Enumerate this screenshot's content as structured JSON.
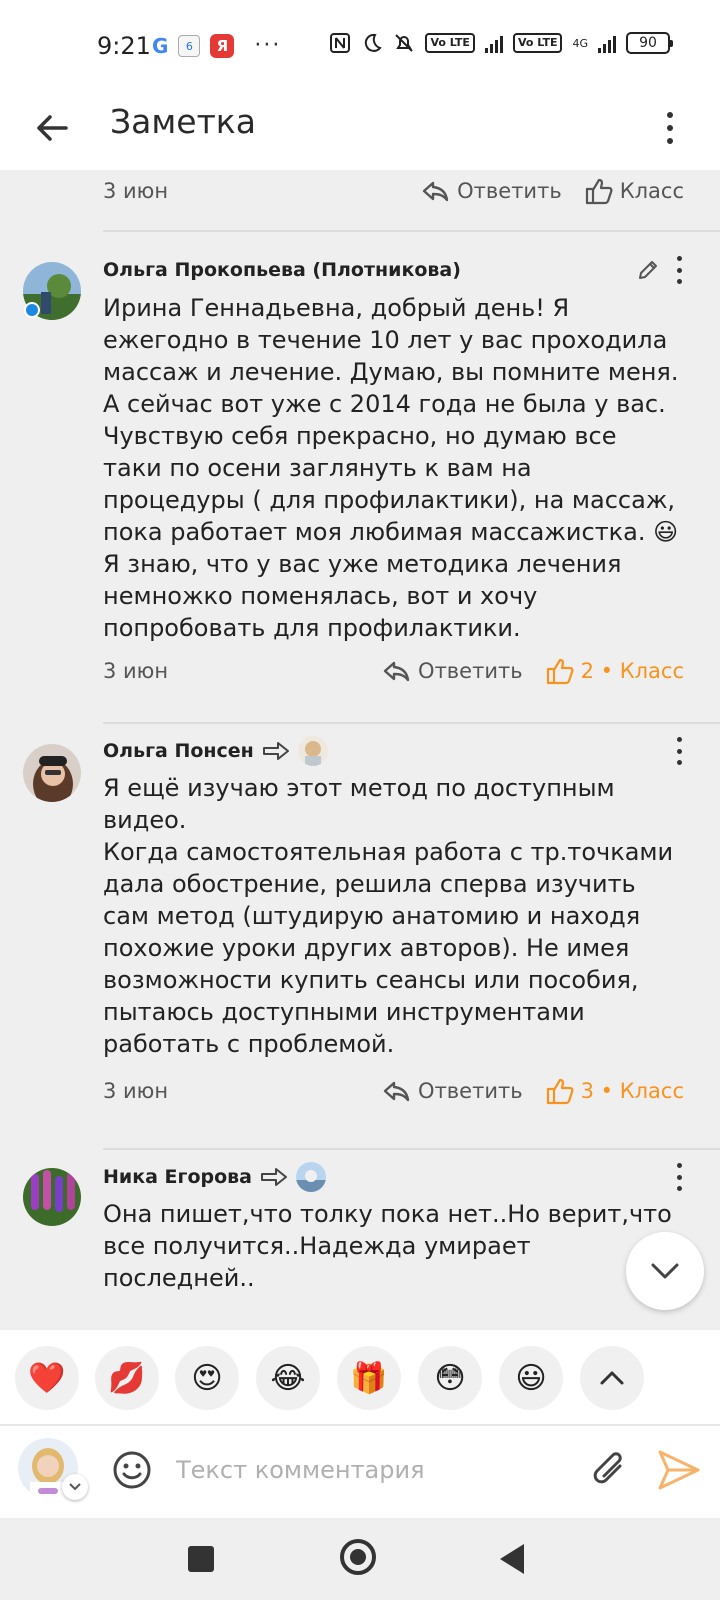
{
  "status_bar": {
    "time": "9:21",
    "g_label": "G",
    "calendar_day": "6",
    "yandex_label": "Я",
    "more": "···",
    "lte1": "Vo LTE",
    "lte2": "Vo LTE",
    "net": "4G",
    "battery": "90"
  },
  "header": {
    "title": "Заметка"
  },
  "feed": {
    "top_meta": {
      "date": "3 июн",
      "reply_label": "Ответить",
      "like_label": "Класс"
    },
    "comments": [
      {
        "author": "Ольга Прокопьева (Плотникова)",
        "text": "Ирина Геннадьевна, добрый день! Я ежегодно в течение 10 лет у вас проходила массаж и лечение. Думаю, вы помните меня. А сейчас вот уже с 2014 года не была у вас. Чувствую себя прекрасно, но думаю все таки по осени заглянуть к вам на процедуры ( для профилактики), на массаж, пока работает моя любимая массажистка.",
        "emoji": "😃",
        "text_after_emoji": " Я знаю, что у вас уже методика лечения немножко поменялась, вот и хочу попробовать для профилактики.",
        "date": "3 июн",
        "reply_label": "Ответить",
        "like_label": "2 • Класс"
      },
      {
        "author": "Ольга Понсен",
        "text": "Я ещё изучаю этот метод по доступным видео.\nКогда самостоятельная работа с тр.точками дала обострение, решила сперва изучить сам метод (штудирую анатомию и находя похожие уроки других авторов). Не имея возможности купить сеансы или пособия, пытаюсь доступными инструментами работать с проблемой.",
        "date": "3 июн",
        "reply_label": "Ответить",
        "like_label": "3 • Класс"
      },
      {
        "author": "Ника Егорова",
        "text": "Она пишет,что толку пока нет..Но верит,что все получится..Надежда умирает последней.."
      }
    ]
  },
  "emoji_bar": {
    "items": [
      "❤️",
      "💋",
      "😍",
      "😂",
      "🎁",
      "😳",
      "😃"
    ]
  },
  "composer": {
    "placeholder": "Текст комментария"
  },
  "colors": {
    "accent": "#f7931e",
    "background": "#efefef",
    "send": "#f7b36b"
  }
}
